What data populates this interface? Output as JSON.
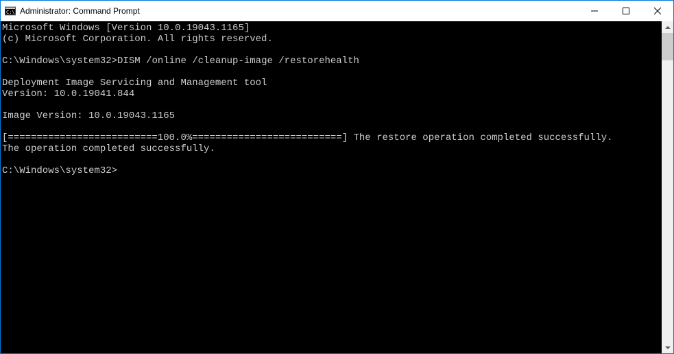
{
  "window": {
    "title": "Administrator: Command Prompt"
  },
  "terminal": {
    "line1": "Microsoft Windows [Version 10.0.19043.1165]",
    "line2": "(c) Microsoft Corporation. All rights reserved.",
    "blank1": "",
    "prompt1_path": "C:\\Windows\\system32>",
    "prompt1_cmd": "DISM /online /cleanup-image /restorehealth",
    "blank2": "",
    "tool_line1": "Deployment Image Servicing and Management tool",
    "tool_line2": "Version: 10.0.19041.844",
    "blank3": "",
    "image_version": "Image Version: 10.0.19043.1165",
    "blank4": "",
    "progress": "[==========================100.0%==========================] The restore operation completed successfully.",
    "completed": "The operation completed successfully.",
    "blank5": "",
    "prompt2": "C:\\Windows\\system32>"
  }
}
